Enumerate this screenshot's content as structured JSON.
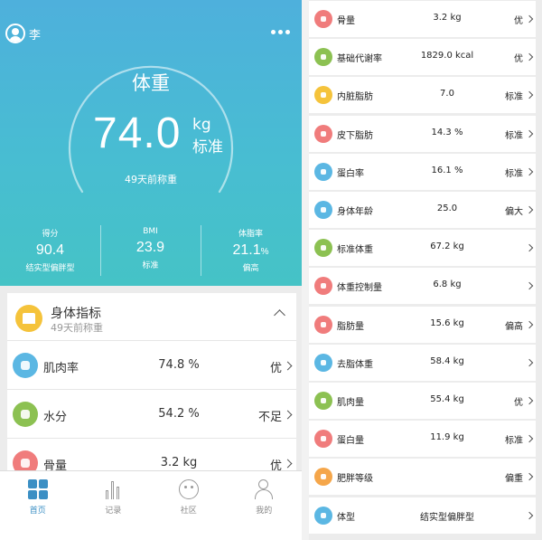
{
  "colors": {
    "hero_top": "#4eb0dc",
    "hero_bottom": "#45c3c6",
    "accent": "#3b8fc4",
    "icon_pink": "#f07c7c",
    "icon_blue": "#5bb7e3",
    "icon_green": "#8cc152",
    "icon_orange": "#f5a64a",
    "icon_yellow": "#f5c33b"
  },
  "header": {
    "user_name": "李",
    "more_icon": "more-dots-icon"
  },
  "gauge": {
    "title": "体重",
    "value": "74.0",
    "unit": "kg",
    "status": "标准",
    "subtitle": "49天前称重"
  },
  "stats": [
    {
      "label": "得分",
      "value": "90.4",
      "unit": "",
      "note": "结实型偏胖型"
    },
    {
      "label": "BMI",
      "value": "23.9",
      "unit": "",
      "note": "标准"
    },
    {
      "label": "体脂率",
      "value": "21.1",
      "unit": "%",
      "note": "偏高"
    }
  ],
  "card": {
    "title": "身体指标",
    "subtitle": "49天前称重",
    "rows": [
      {
        "icon": "muscle-rate-icon",
        "color": "#5bb7e3",
        "label": "肌肉率",
        "value": "74.8 %",
        "status": "优"
      },
      {
        "icon": "water-drop-icon",
        "color": "#8cc152",
        "label": "水分",
        "value": "54.2 %",
        "status": "不足"
      },
      {
        "icon": "bone-icon",
        "color": "#f07c7c",
        "label": "骨量",
        "value": "3.2 kg",
        "status": "优"
      }
    ]
  },
  "tabbar": {
    "tabs": [
      {
        "label": "首页",
        "icon": "home-grid-icon"
      },
      {
        "label": "记录",
        "icon": "records-chart-icon"
      },
      {
        "label": "社区",
        "icon": "community-icon"
      },
      {
        "label": "我的",
        "icon": "profile-icon"
      }
    ]
  },
  "metrics": [
    {
      "icon": "bone-icon",
      "color": "#f07c7c",
      "label": "骨量",
      "value": "3.2 kg",
      "status": "优"
    },
    {
      "icon": "metabolism-icon",
      "color": "#8cc152",
      "label": "基础代谢率",
      "value": "1829.0 kcal",
      "status": "优"
    },
    {
      "icon": "visceral-fat-icon",
      "color": "#f5c33b",
      "label": "内脏脂肪",
      "value": "7.0",
      "status": "标准"
    },
    {
      "icon": "subcutaneous-fat-icon",
      "color": "#f07c7c",
      "label": "皮下脂肪",
      "value": "14.3 %",
      "status": "标准"
    },
    {
      "icon": "protein-rate-icon",
      "color": "#5bb7e3",
      "label": "蛋白率",
      "value": "16.1 %",
      "status": "标准"
    },
    {
      "icon": "body-age-icon",
      "color": "#5bb7e3",
      "label": "身体年龄",
      "value": "25.0",
      "status": "偏大"
    },
    {
      "icon": "standard-weight-icon",
      "color": "#8cc152",
      "label": "标准体重",
      "value": "67.2 kg",
      "status": ""
    },
    {
      "icon": "weight-control-icon",
      "color": "#f07c7c",
      "label": "体重控制量",
      "value": "6.8 kg",
      "status": ""
    },
    {
      "icon": "fat-mass-icon",
      "color": "#f07c7c",
      "label": "脂肪量",
      "value": "15.6 kg",
      "status": "偏高"
    },
    {
      "icon": "lean-mass-icon",
      "color": "#5bb7e3",
      "label": "去脂体重",
      "value": "58.4 kg",
      "status": ""
    },
    {
      "icon": "muscle-mass-icon",
      "color": "#8cc152",
      "label": "肌肉量",
      "value": "55.4 kg",
      "status": "优"
    },
    {
      "icon": "protein-mass-icon",
      "color": "#f07c7c",
      "label": "蛋白量",
      "value": "11.9 kg",
      "status": "标准"
    },
    {
      "icon": "obesity-level-icon",
      "color": "#f5a64a",
      "label": "肥胖等级",
      "value": "",
      "status": "偏重"
    },
    {
      "icon": "body-type-icon",
      "color": "#5bb7e3",
      "label": "体型",
      "value": "结实型偏胖型",
      "status": ""
    }
  ]
}
